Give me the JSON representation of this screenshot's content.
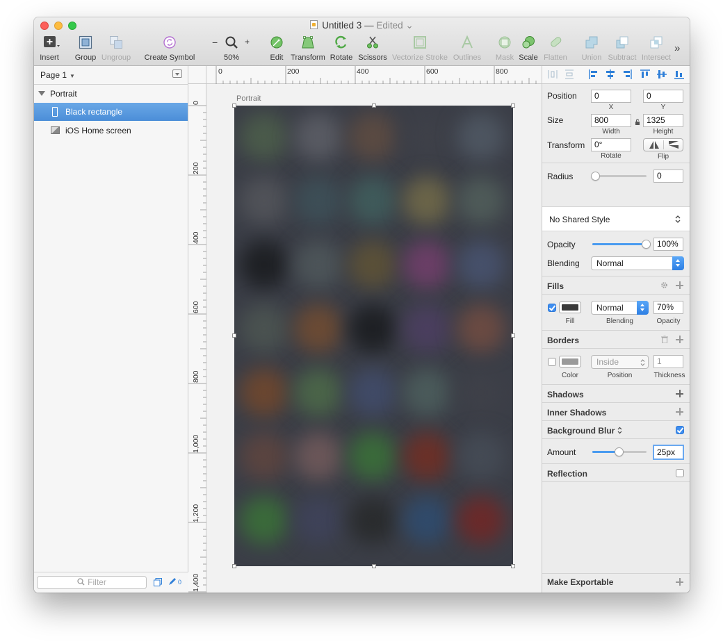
{
  "window": {
    "title": "Untitled 3",
    "title_sep": "—",
    "status": "Edited"
  },
  "toolbar": {
    "items": [
      {
        "label": "Insert",
        "icon": "insert-plus-icon"
      },
      {
        "label": "Group",
        "icon": "group-icon"
      },
      {
        "label": "Ungroup",
        "icon": "ungroup-icon"
      },
      {
        "label": "Create Symbol",
        "icon": "symbol-icon"
      },
      {
        "label": "50%",
        "icon": "zoom-magnifier-icon"
      },
      {
        "label": "Edit",
        "icon": "edit-icon"
      },
      {
        "label": "Transform",
        "icon": "transform-icon"
      },
      {
        "label": "Rotate",
        "icon": "rotate-icon"
      },
      {
        "label": "Scissors",
        "icon": "scissors-icon"
      },
      {
        "label": "Vectorize Stroke",
        "icon": "vectorize-stroke-icon"
      },
      {
        "label": "Outlines",
        "icon": "outlines-icon"
      },
      {
        "label": "Mask",
        "icon": "mask-icon"
      },
      {
        "label": "Scale",
        "icon": "scale-icon"
      },
      {
        "label": "Flatten",
        "icon": "flatten-icon"
      },
      {
        "label": "Union",
        "icon": "union-icon"
      },
      {
        "label": "Subtract",
        "icon": "subtract-icon"
      },
      {
        "label": "Intersect",
        "icon": "intersect-icon"
      }
    ],
    "zoom_minus": "−",
    "zoom_plus": "+",
    "overflow": "»"
  },
  "layers": {
    "page_label": "Page 1",
    "items": [
      {
        "label": "Portrait",
        "type": "artboard"
      },
      {
        "label": "Black rectangle",
        "type": "rectangle",
        "selected": true
      },
      {
        "label": "iOS Home screen",
        "type": "image"
      }
    ],
    "filter_placeholder": "Filter",
    "slice_count": "0"
  },
  "canvas": {
    "artboard_name": "Portrait",
    "ruler_top": [
      "0",
      "200",
      "400",
      "600",
      "800"
    ],
    "ruler_left": [
      "0",
      "200",
      "400",
      "600",
      "800",
      "1,000",
      "1,200",
      "1,400"
    ]
  },
  "inspector": {
    "position_label": "Position",
    "position_x": "0",
    "position_y": "0",
    "x_label": "X",
    "y_label": "Y",
    "size_label": "Size",
    "width": "800",
    "height": "1325",
    "width_label": "Width",
    "height_label": "Height",
    "transform_label": "Transform",
    "rotate": "0°",
    "rotate_label": "Rotate",
    "flip_label": "Flip",
    "radius_label": "Radius",
    "radius": "0",
    "shared_style": "No Shared Style",
    "opacity_label": "Opacity",
    "opacity": "100%",
    "opacity_level": 1.0,
    "blending_label": "Blending",
    "blending": "Normal",
    "fills": {
      "header": "Fills",
      "enabled": true,
      "color": "#3a3a3a",
      "blending": "Normal",
      "opacity": "70%",
      "fill_label": "Fill",
      "blending_label": "Blending",
      "opacity_label": "Opacity"
    },
    "borders": {
      "header": "Borders",
      "enabled": false,
      "color": "#9a9a9a",
      "position": "Inside",
      "thickness": "1",
      "color_label": "Color",
      "position_label": "Position",
      "thickness_label": "Thickness"
    },
    "shadows_header": "Shadows",
    "inner_shadows_header": "Inner Shadows",
    "background_blur_header": "Background Blur",
    "background_blur_enabled": true,
    "amount_label": "Amount",
    "amount": "25px",
    "amount_level": 0.5,
    "reflection_header": "Reflection",
    "reflection_enabled": false,
    "exportable_header": "Make Exportable"
  },
  "colors": {
    "accent": "#4a9bf0",
    "selection": "#5b9ce0",
    "artboard_bg": "#3b3e47"
  }
}
